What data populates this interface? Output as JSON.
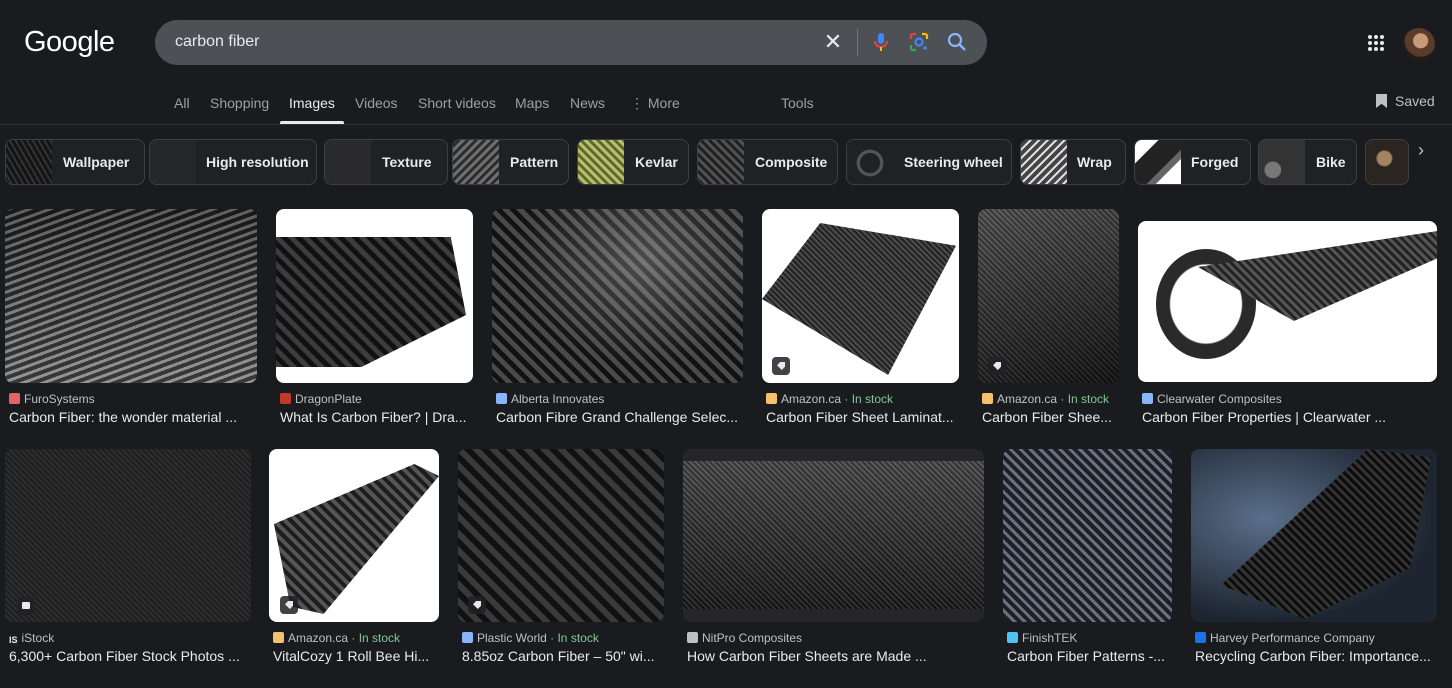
{
  "header": {
    "logo": "Google",
    "query": "carbon fiber",
    "clear_icon": "close-icon",
    "mic_icon": "mic-icon",
    "lens_icon": "google-lens-icon",
    "search_icon": "search-icon",
    "apps_icon": "apps-grid-icon"
  },
  "tabs": {
    "all": "All",
    "shopping": "Shopping",
    "images": "Images",
    "videos": "Videos",
    "short_videos": "Short videos",
    "maps": "Maps",
    "news": "News",
    "more": "⋮ More",
    "tools": "Tools",
    "saved": "Saved"
  },
  "chips": [
    {
      "label": "Wallpaper"
    },
    {
      "label": "High resolution"
    },
    {
      "label": "Texture"
    },
    {
      "label": "Pattern"
    },
    {
      "label": "Kevlar"
    },
    {
      "label": "Composite"
    },
    {
      "label": "Steering wheel"
    },
    {
      "label": "Wrap"
    },
    {
      "label": "Forged"
    },
    {
      "label": "Bike"
    }
  ],
  "results": [
    {
      "source": "FuroSystems",
      "stock": "",
      "title": "Carbon Fiber: the wonder material ..."
    },
    {
      "source": "DragonPlate",
      "stock": "",
      "title": "What Is Carbon Fiber? | Dra..."
    },
    {
      "source": "Alberta Innovates",
      "stock": "",
      "title": "Carbon Fibre Grand Challenge Selec..."
    },
    {
      "source": "Amazon.ca",
      "stock": "· In stock",
      "title": "Carbon Fiber Sheet Laminat..."
    },
    {
      "source": "Amazon.ca",
      "stock": "· In stock",
      "title": "Carbon Fiber Shee..."
    },
    {
      "source": "Clearwater Composites",
      "stock": "",
      "title": "Carbon Fiber Properties | Clearwater ..."
    },
    {
      "source": "iStock",
      "stock": "",
      "title": "6,300+ Carbon Fiber Stock Photos ..."
    },
    {
      "source": "Amazon.ca",
      "stock": "· In stock",
      "title": "VitalCozy 1 Roll Bee Hi..."
    },
    {
      "source": "Plastic World",
      "stock": "· In stock",
      "title": "8.85oz Carbon Fiber – 50\" wi..."
    },
    {
      "source": "NitPro Composites",
      "stock": "",
      "title": "How Carbon Fiber Sheets are Made ..."
    },
    {
      "source": "FinishTEK",
      "stock": "",
      "title": "Carbon Fiber Patterns -..."
    },
    {
      "source": "Harvey Performance Company",
      "stock": "",
      "title": "Recycling Carbon Fiber: Importance..."
    }
  ],
  "colors": {
    "background": "#1a1b1f",
    "search_bg": "#4d5156",
    "in_stock": "#81c995"
  }
}
